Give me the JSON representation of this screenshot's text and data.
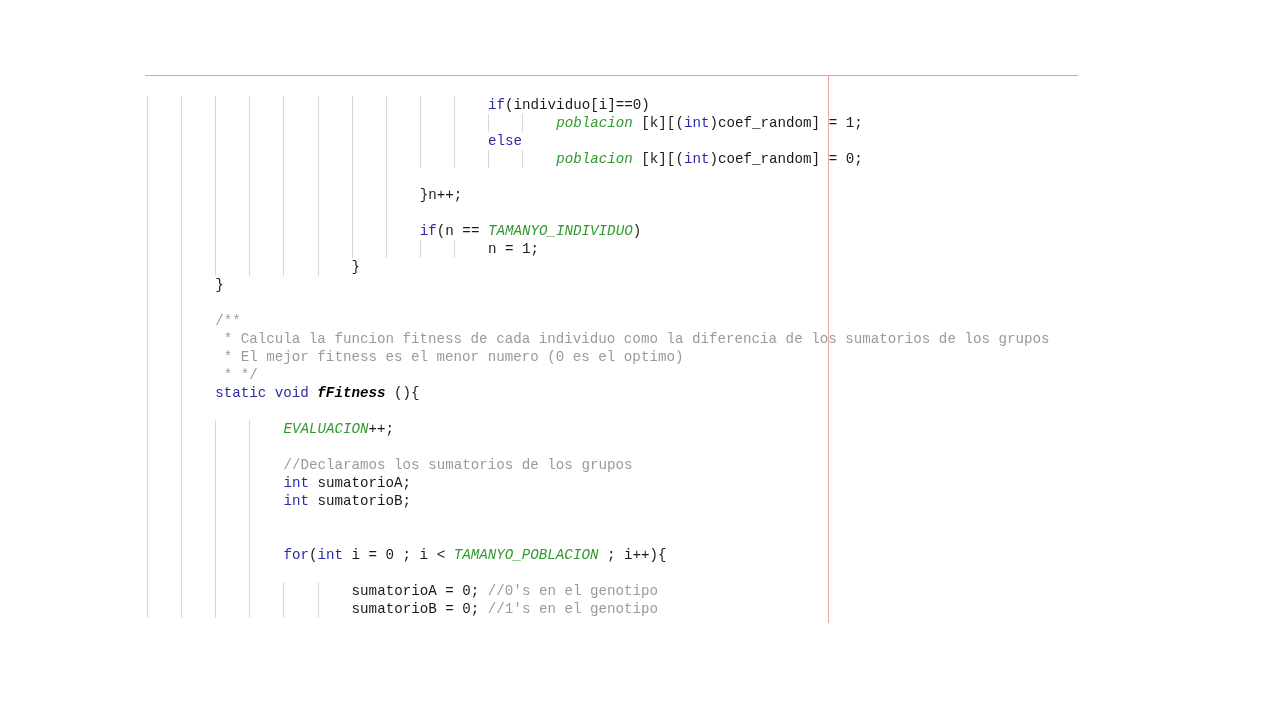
{
  "editor": {
    "lines": [
      {
        "kind": "code",
        "tokens": [
          {
            "kind": "keyword",
            "text": "\t\t\t\t\t\t\t\t\t\tif"
          },
          {
            "kind": "plain",
            "text": "(individuo[i]==0)"
          }
        ]
      },
      {
        "kind": "code",
        "tokens": [
          {
            "kind": "field",
            "text": "\t\t\t\t\t\t\t\t\t\t\t\tpoblacion"
          },
          {
            "kind": "plain",
            "text": " [k][("
          },
          {
            "kind": "keyword",
            "text": "int"
          },
          {
            "kind": "plain",
            "text": ")coef_random] = 1;"
          }
        ]
      },
      {
        "kind": "code",
        "tokens": [
          {
            "kind": "keyword",
            "text": "\t\t\t\t\t\t\t\t\t\telse"
          }
        ]
      },
      {
        "kind": "code",
        "tokens": [
          {
            "kind": "field",
            "text": "\t\t\t\t\t\t\t\t\t\t\t\tpoblacion"
          },
          {
            "kind": "plain",
            "text": " [k][("
          },
          {
            "kind": "keyword",
            "text": "int"
          },
          {
            "kind": "plain",
            "text": ")coef_random] = 0;"
          }
        ]
      },
      {
        "kind": "blank"
      },
      {
        "kind": "code",
        "tokens": [
          {
            "kind": "plain",
            "text": "\t\t\t\t\t\t\t\t}n++;"
          }
        ]
      },
      {
        "kind": "blank"
      },
      {
        "kind": "code",
        "tokens": [
          {
            "kind": "keyword",
            "text": "\t\t\t\t\t\t\t\tif"
          },
          {
            "kind": "plain",
            "text": "(n == "
          },
          {
            "kind": "field",
            "text": "TAMANYO_INDIVIDUO"
          },
          {
            "kind": "plain",
            "text": ")"
          }
        ]
      },
      {
        "kind": "code",
        "tokens": [
          {
            "kind": "plain",
            "text": "\t\t\t\t\t\t\t\t\t\tn = 1;"
          }
        ]
      },
      {
        "kind": "code",
        "tokens": [
          {
            "kind": "plain",
            "text": "\t\t\t\t\t\t}"
          }
        ]
      },
      {
        "kind": "code",
        "tokens": [
          {
            "kind": "plain",
            "text": "\t\t}"
          }
        ]
      },
      {
        "kind": "blank"
      },
      {
        "kind": "code",
        "tokens": [
          {
            "kind": "comment",
            "text": "\t\t/**"
          }
        ]
      },
      {
        "kind": "code",
        "tokens": [
          {
            "kind": "comment",
            "text": "\t\t * Calcula la funcion fitness de cada individuo como la diferencia de los sumatorios de los grupos"
          }
        ]
      },
      {
        "kind": "code",
        "tokens": [
          {
            "kind": "comment",
            "text": "\t\t * El mejor fitness es el menor numero (0 es el optimo)"
          }
        ]
      },
      {
        "kind": "code",
        "tokens": [
          {
            "kind": "comment",
            "text": "\t\t * */"
          }
        ]
      },
      {
        "kind": "code",
        "tokens": [
          {
            "kind": "keyword",
            "text": "\t\tstatic void"
          },
          {
            "kind": "method",
            "text": " fFitness"
          },
          {
            "kind": "plain",
            "text": " (){"
          }
        ]
      },
      {
        "kind": "blank"
      },
      {
        "kind": "code",
        "tokens": [
          {
            "kind": "field",
            "text": "\t\t\t\tEVALUACION"
          },
          {
            "kind": "plain",
            "text": "++;"
          }
        ]
      },
      {
        "kind": "blank"
      },
      {
        "kind": "code",
        "tokens": [
          {
            "kind": "comment",
            "text": "\t\t\t\t//Declaramos los sumatorios de los grupos"
          }
        ]
      },
      {
        "kind": "code",
        "tokens": [
          {
            "kind": "keyword",
            "text": "\t\t\t\tint"
          },
          {
            "kind": "plain",
            "text": " sumatorioA;"
          }
        ]
      },
      {
        "kind": "code",
        "tokens": [
          {
            "kind": "keyword",
            "text": "\t\t\t\tint"
          },
          {
            "kind": "plain",
            "text": " sumatorioB;"
          }
        ]
      },
      {
        "kind": "blank"
      },
      {
        "kind": "blank"
      },
      {
        "kind": "code",
        "tokens": [
          {
            "kind": "keyword",
            "text": "\t\t\t\tfor"
          },
          {
            "kind": "plain",
            "text": "("
          },
          {
            "kind": "keyword",
            "text": "int"
          },
          {
            "kind": "plain",
            "text": " i = 0 ; i < "
          },
          {
            "kind": "field",
            "text": "TAMANYO_POBLACION"
          },
          {
            "kind": "plain",
            "text": " ; i++){"
          }
        ]
      },
      {
        "kind": "blank"
      },
      {
        "kind": "code",
        "tokens": [
          {
            "kind": "plain",
            "text": "\t\t\t\t\t\tsumatorioA = 0; "
          },
          {
            "kind": "comment",
            "text": "//0's en el genotipo"
          }
        ]
      },
      {
        "kind": "code",
        "tokens": [
          {
            "kind": "plain",
            "text": "\t\t\t\t\t\tsumatorioB = 0; "
          },
          {
            "kind": "comment",
            "text": "//1's en el genotipo"
          }
        ]
      }
    ]
  }
}
